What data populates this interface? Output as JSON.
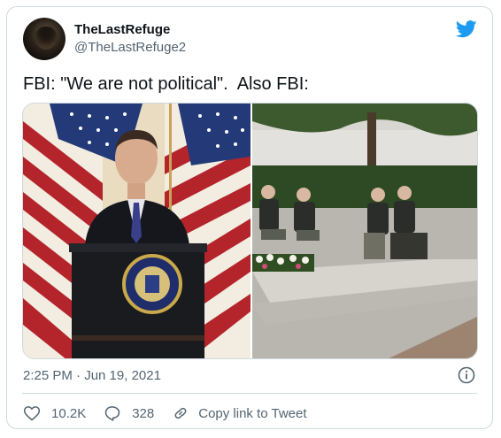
{
  "tweet": {
    "author_name": "TheLastRefuge",
    "author_handle": "@TheLastRefuge2",
    "text": "FBI: \"We are not political\".  Also FBI:",
    "time": "2:25 PM · Jun 19, 2021"
  },
  "actions": {
    "likes": "10.2K",
    "replies": "328",
    "copy_link_label": "Copy link to Tweet"
  },
  "icons": {
    "brand": "twitter-bird-icon",
    "info": "info-icon",
    "like": "heart-icon",
    "reply": "reply-bubble-icon",
    "copy": "link-icon"
  },
  "colors": {
    "brand_blue": "#1d9bf0",
    "secondary_text": "#536471",
    "border": "#cfd9de"
  }
}
